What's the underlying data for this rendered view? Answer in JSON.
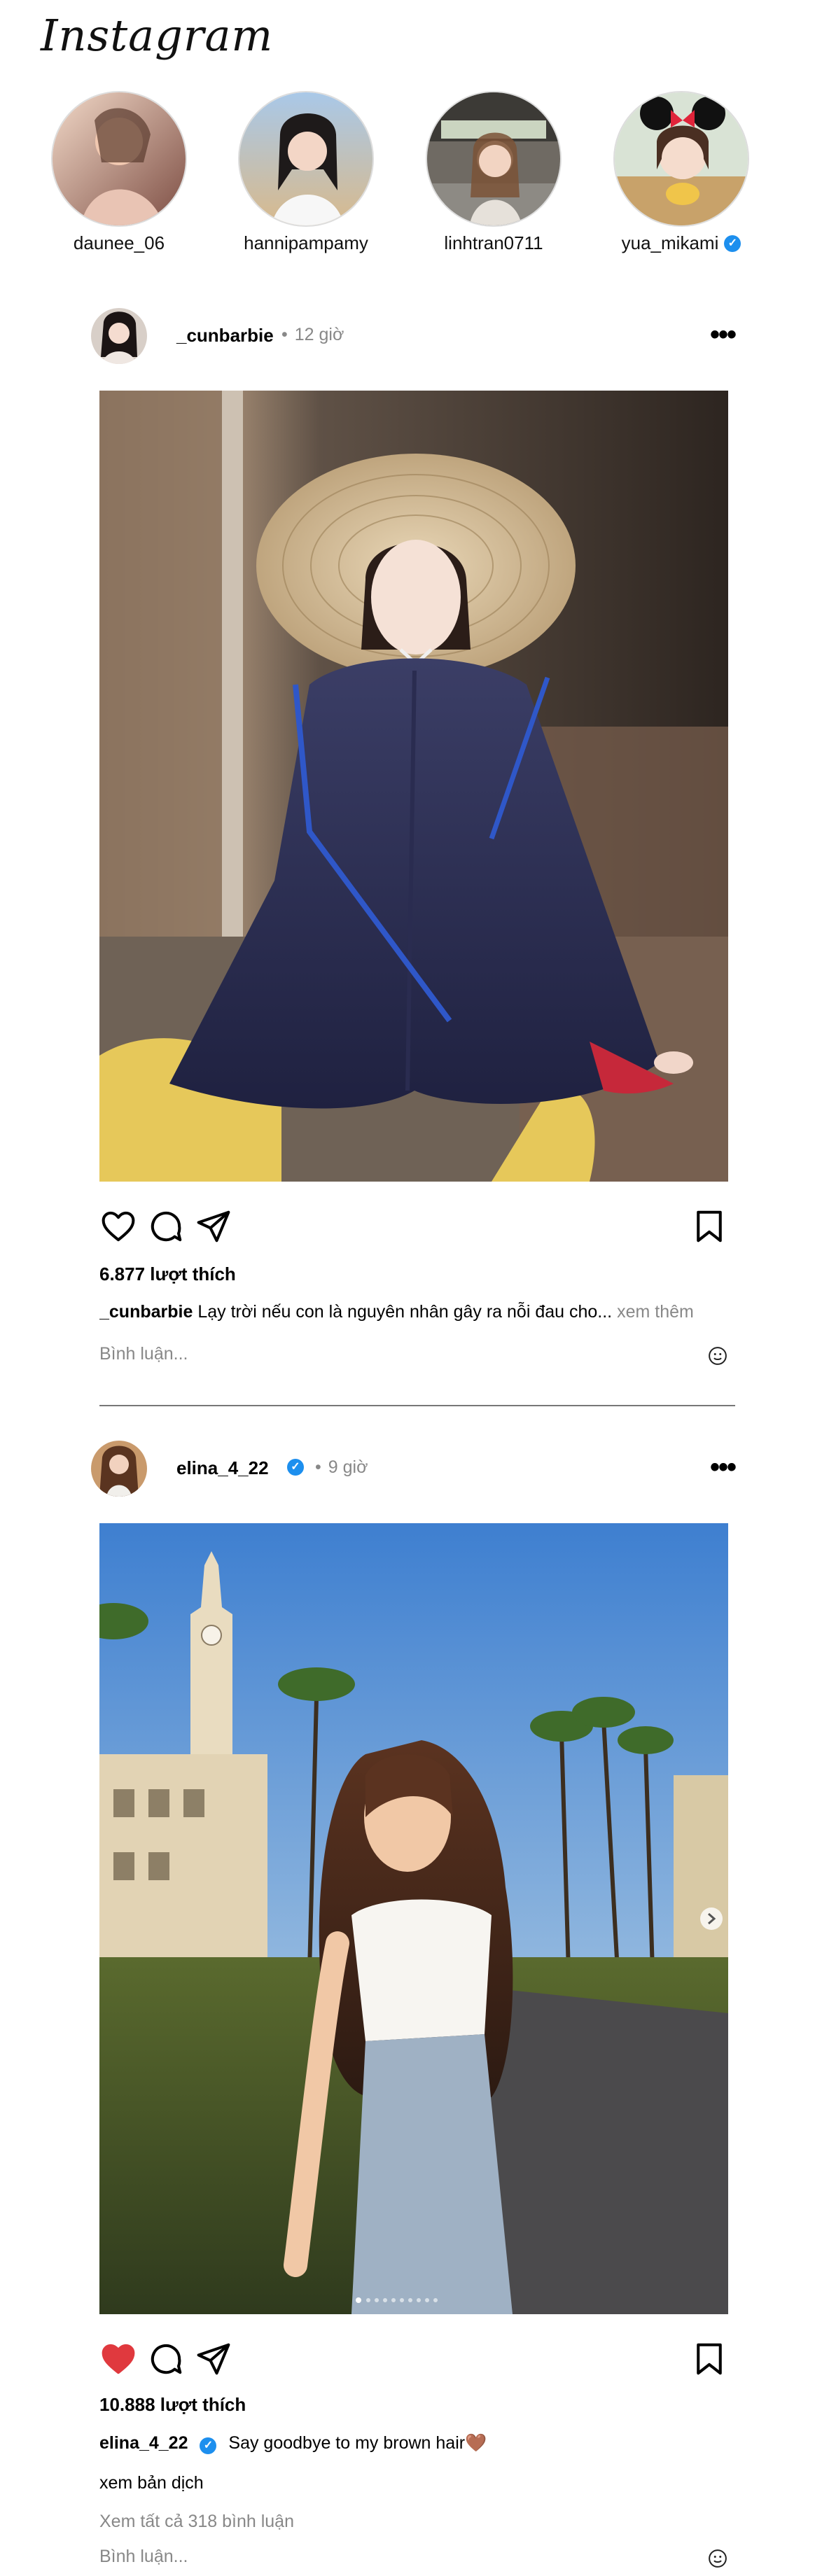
{
  "app": {
    "logo": "Instagram"
  },
  "stories": [
    {
      "username": "daunee_06",
      "verified": false
    },
    {
      "username": "hannipampamy",
      "verified": false
    },
    {
      "username": "linhtran0711",
      "verified": false
    },
    {
      "username": "yua_mikami",
      "verified": true
    }
  ],
  "posts": [
    {
      "username": "_cunbarbie",
      "time": "12 giờ",
      "verified": false,
      "likes": "6.877 lượt thích",
      "caption_user": "_cunbarbie",
      "caption_text": "Lạy trời nếu con là nguyên nhân gây ra nỗi đau cho...",
      "see_more": "xem thêm",
      "comment_placeholder": "Bình luận...",
      "liked": false
    },
    {
      "username": "elina_4_22",
      "time": "9 giờ",
      "verified": true,
      "likes": "10.888 lượt thích",
      "caption_user": "elina_4_22",
      "caption_text": "Say goodbye to my brown hair🤎",
      "translate": "xem bản dịch",
      "view_comments": "Xem tất cả 318 bình luận",
      "comment_placeholder": "Bình luận...",
      "liked": true,
      "carousel": {
        "count": 10,
        "active": 1
      }
    }
  ],
  "icons": {
    "heart": "heart-icon",
    "comment": "comment-icon",
    "share": "share-icon",
    "bookmark": "bookmark-icon",
    "more": "more-icon",
    "emoji": "emoji-icon"
  },
  "colors": {
    "like_red": "#e0393e",
    "verified_blue": "#1d8fee",
    "muted": "#888888"
  }
}
